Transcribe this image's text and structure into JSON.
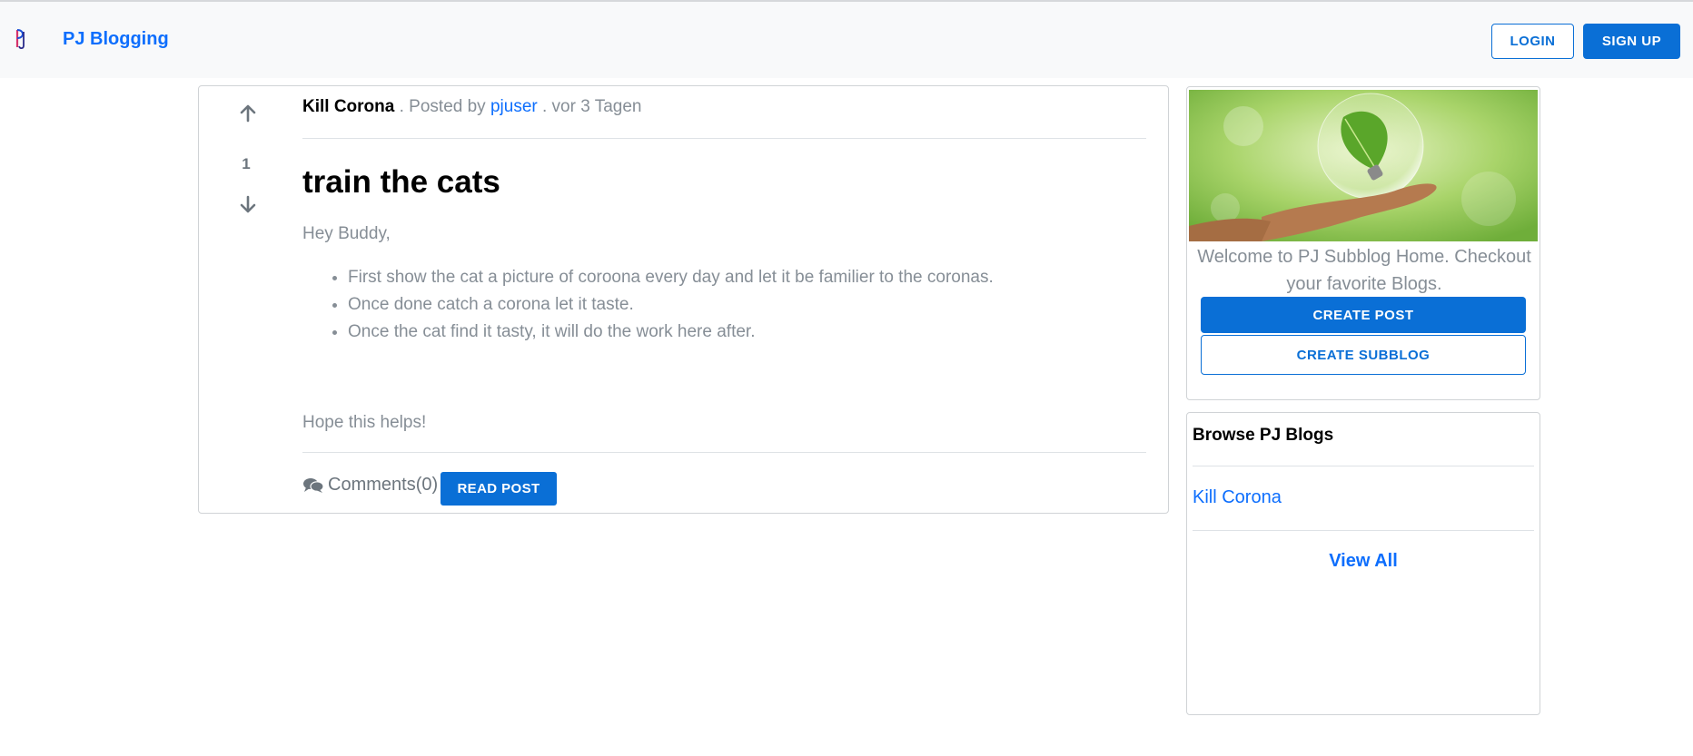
{
  "header": {
    "brand_name": "PJ Blogging",
    "login_label": "LOGIN",
    "signup_label": "SIGN UP"
  },
  "post": {
    "vote_count": "1",
    "subblog": "Kill Corona",
    "posted_by_text": ". Posted by",
    "author": "pjuser",
    "time_text": ". vor 3 Tagen",
    "title": "train the cats",
    "greeting": "Hey Buddy,",
    "bullets": [
      "First show the cat a picture of coroona every day and let it be familier to the coronas.",
      "Once done catch a corona let it taste.",
      "Once the cat find it tasty, it will do the work here after."
    ],
    "closing": "Hope this helps!",
    "comments_label": "Comments(0)",
    "read_post_label": "READ POST"
  },
  "sidebar": {
    "welcome_text": "Welcome to PJ Subblog Home. Checkout your favorite Blogs.",
    "create_post_label": "CREATE POST",
    "create_subblog_label": "CREATE SUBBLOG",
    "browse_title": "Browse PJ Blogs",
    "browse_items": [
      "Kill Corona"
    ],
    "view_all_label": "View All"
  },
  "colors": {
    "primary": "#0a6fd6",
    "link": "#0d6efd",
    "muted": "#868e96",
    "navbar_bg": "#f8f9fa"
  },
  "icons": {
    "vote_up": "arrow-up-icon",
    "vote_down": "arrow-down-icon",
    "comments": "comments-icon",
    "brand": "brand-logo-icon"
  }
}
